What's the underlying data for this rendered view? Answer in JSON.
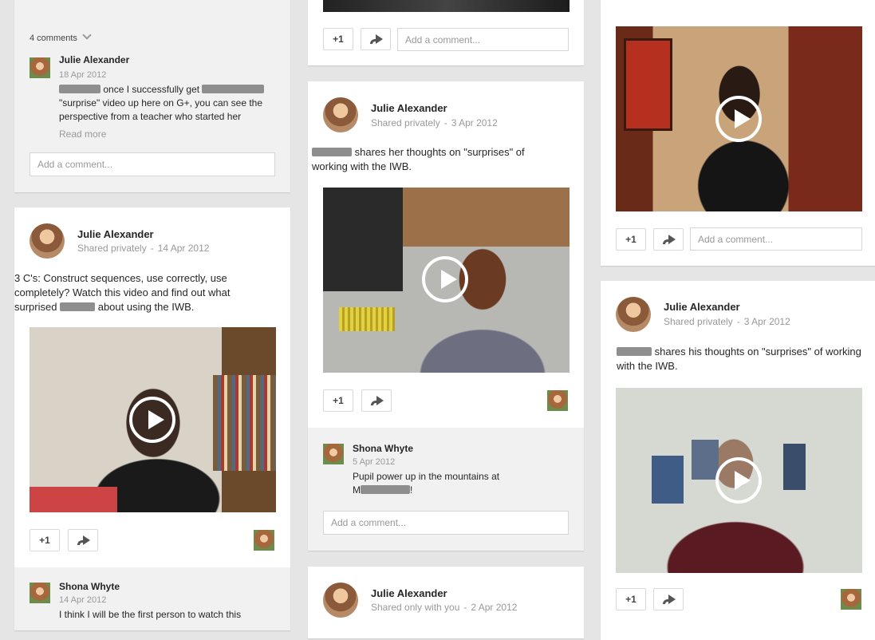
{
  "col1": {
    "top_card": {
      "comments_count": "4 comments",
      "comment": {
        "author": "Julie Alexander",
        "date": "18 Apr 2012",
        "text_line1": "once I successfully get",
        "text_line2": "\"surprise\" video up here on G+, you can see the",
        "text_line3": "perspective from a teacher who started her",
        "read_more": "Read more"
      },
      "comment_placeholder": "Add a comment..."
    },
    "post": {
      "author": "Julie Alexander",
      "visibility": "Shared privately",
      "date": "14 Apr 2012",
      "text_line1": "3 C's: Construct sequences, use correctly, use",
      "text_line2": "completely? Watch this video and find out what",
      "text_line3a": "surprised",
      "text_line3b": "about using the IWB.",
      "plus_one": "+1",
      "comment": {
        "author": "Shona Whyte",
        "date": "14 Apr 2012",
        "text": "I think I will be the first person to watch this"
      }
    }
  },
  "col2": {
    "top_card": {
      "plus_one": "+1",
      "comment_placeholder": "Add a comment..."
    },
    "post": {
      "author": "Julie Alexander",
      "visibility": "Shared privately",
      "date": "3 Apr 2012",
      "text_line1": "shares her thoughts on \"surprises\" of",
      "text_line2": "working with the IWB.",
      "plus_one": "+1",
      "comment": {
        "author": "Shona Whyte",
        "date": "5 Apr 2012",
        "text_line1": "Pupil power up in the mountains at",
        "text_line2a": "M",
        "text_line2b": "!"
      },
      "comment_placeholder": "Add a comment..."
    },
    "bottom_card": {
      "author": "Julie Alexander",
      "visibility": "Shared only with you",
      "date": "2 Apr 2012"
    }
  },
  "col3": {
    "top_card": {
      "plus_one": "+1",
      "comment_placeholder": "Add a comment..."
    },
    "post": {
      "author": "Julie Alexander",
      "visibility": "Shared privately",
      "date": "3 Apr 2012",
      "text_line1": "shares his thoughts on \"surprises\" of working",
      "text_line2": "with the IWB.",
      "plus_one": "+1"
    }
  },
  "icons": {
    "play": "play-icon",
    "share": "share-icon",
    "chevron": "chevron-down-icon"
  },
  "colors": {
    "background": "#e5e5e5",
    "card": "#ffffff",
    "comment_area": "#f1f1f1",
    "meta_text": "#999999"
  }
}
